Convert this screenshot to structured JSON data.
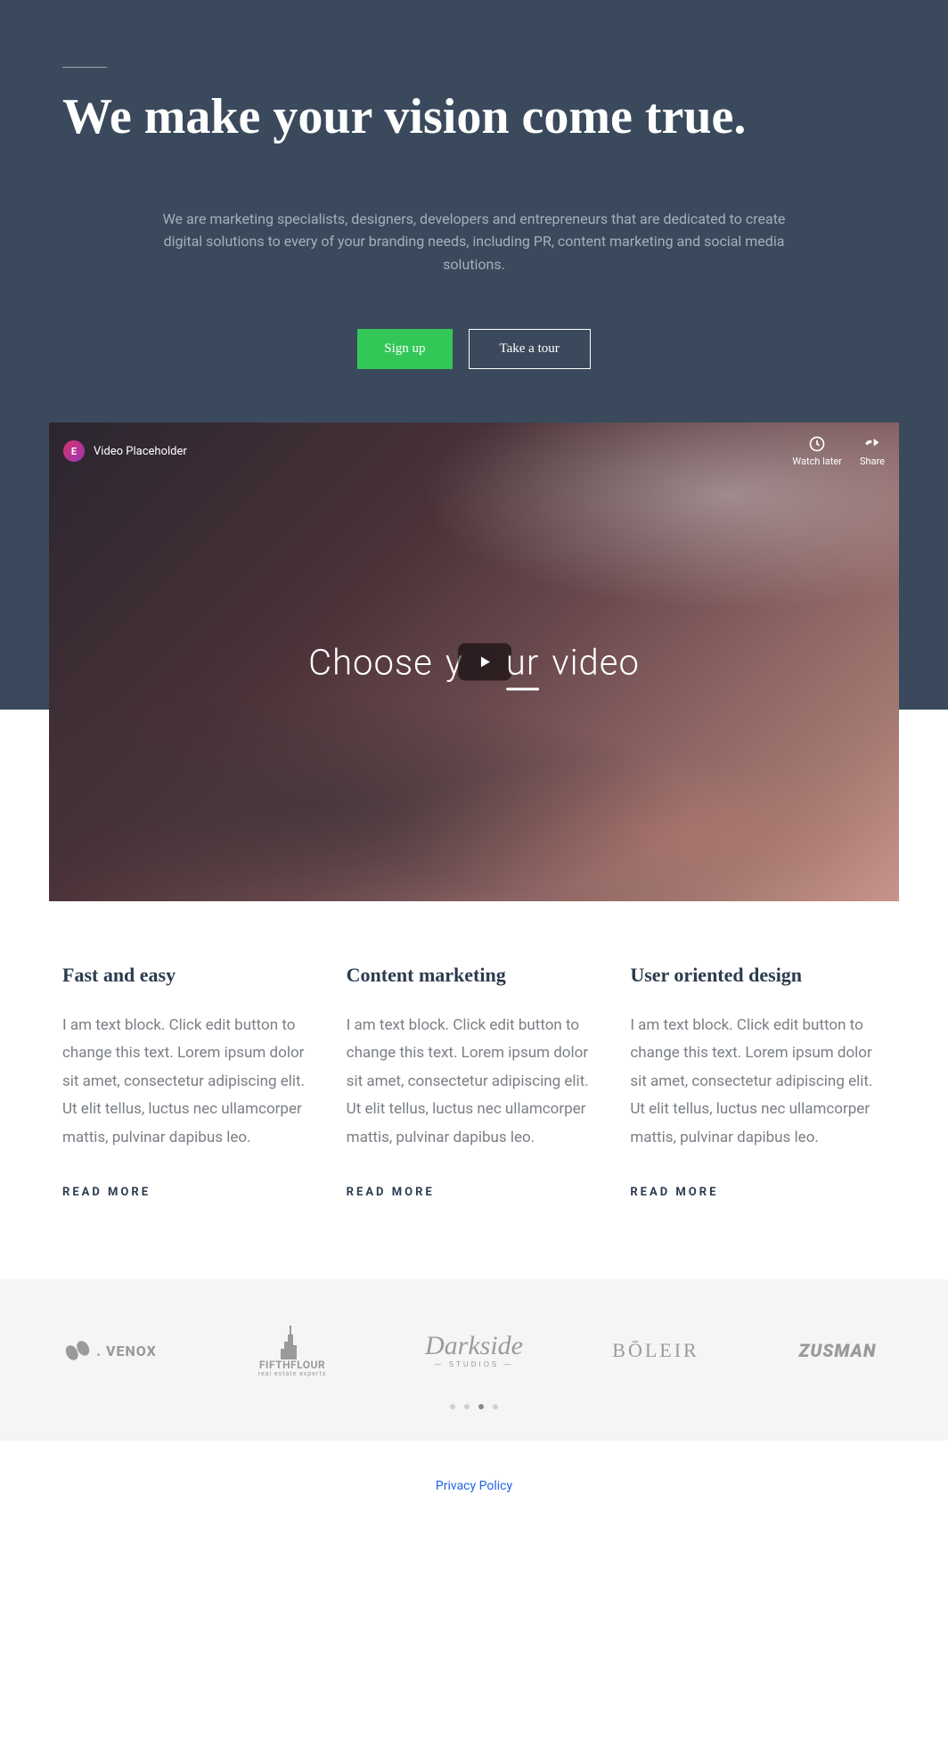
{
  "hero": {
    "title": "We make your vision come true.",
    "subtitle": "We are marketing specialists, designers, developers and entrepreneurs that are dedicated to create digital solutions to every of your branding needs, including PR, content marketing and social media solutions.",
    "signup_label": "Sign up",
    "tour_label": "Take a tour"
  },
  "video": {
    "title": "Video Placeholder",
    "watch_later": "Watch later",
    "share": "Share",
    "overlay_word1": "Choose",
    "overlay_word2": "your",
    "overlay_word3": "video"
  },
  "features": [
    {
      "title": "Fast and easy",
      "text": "I am text block. Click edit button to change this text. Lorem ipsum dolor sit amet, consectetur adipiscing elit. Ut elit tellus, luctus nec ullamcorper mattis, pulvinar dapibus leo.",
      "link": "READ MORE"
    },
    {
      "title": "Content marketing",
      "text": "I am text block. Click edit button to change this text. Lorem ipsum dolor sit amet, consectetur adipiscing elit. Ut elit tellus, luctus nec ullamcorper mattis, pulvinar dapibus leo.",
      "link": "READ MORE"
    },
    {
      "title": "User oriented design",
      "text": "I am text block. Click edit button to change this text. Lorem ipsum dolor sit amet, consectetur adipiscing elit. Ut elit tellus, luctus nec ullamcorper mattis, pulvinar dapibus leo.",
      "link": "READ MORE"
    }
  ],
  "logos": {
    "venox": ". VENOX",
    "fifthflour": "FIFTHFLOUR",
    "fifthflour_sub": "real estate experts",
    "darkside": "Darkside",
    "darkside_sub": "— STUDIOS —",
    "boleir": "BŌLEIR",
    "zusman": "ZUSMAN"
  },
  "carousel": {
    "active_index": 2,
    "count": 4
  },
  "footer": {
    "privacy": "Privacy Policy"
  }
}
